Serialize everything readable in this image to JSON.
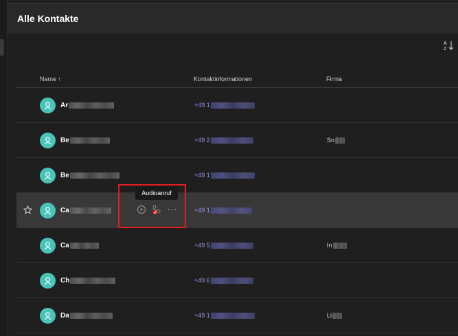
{
  "page": {
    "title": "Alle Kontakte"
  },
  "toolbar": {
    "sort_icon": "sort-az-icon"
  },
  "columns": {
    "name": "Name ↑",
    "contact": "Kontaktinformationen",
    "company": "Firma"
  },
  "rows": [
    {
      "name": "Ar",
      "phone": "+49 1",
      "company": ""
    },
    {
      "name": "Be",
      "phone": "+49 2",
      "company": "Sn"
    },
    {
      "name": "Be",
      "phone": "+49 1",
      "company": ""
    },
    {
      "name": "Ca",
      "phone": "+49 1",
      "company": ""
    },
    {
      "name": "Ca",
      "phone": "+49 5",
      "company": "In"
    },
    {
      "name": "Ch",
      "phone": "+49 6",
      "company": ""
    },
    {
      "name": "Da",
      "phone": "+49 1",
      "company": "Li"
    }
  ],
  "tooltip": {
    "text": "Audioanruf"
  },
  "colors": {
    "avatar": "#4ac4b8",
    "phone": "#9a9af0",
    "highlight": "#e11d1d",
    "row_hover": "#383838"
  }
}
